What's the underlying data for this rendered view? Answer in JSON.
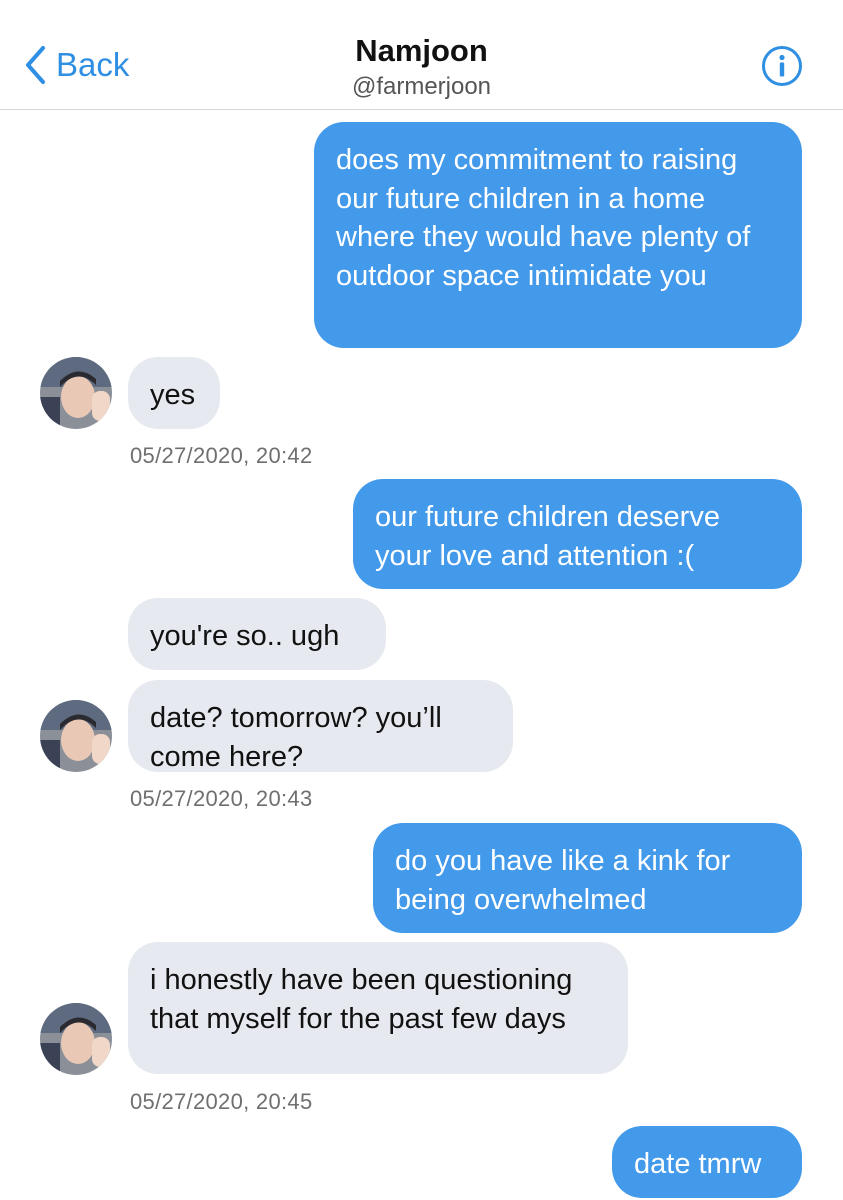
{
  "header": {
    "back_label": "Back",
    "title": "Namjoon",
    "handle": "@farmerjoon"
  },
  "colors": {
    "accent": "#2f8fe3",
    "outgoing_bubble": "#4399ea",
    "incoming_bubble": "#e6e9ef"
  },
  "messages": [
    {
      "direction": "outgoing",
      "text": "does my commitment to raising our future children in a home where they would have plenty of outdoor space intimidate you"
    },
    {
      "direction": "incoming",
      "text": "yes"
    },
    {
      "direction": "outgoing",
      "text": "our future children deserve your love and attention :("
    },
    {
      "direction": "incoming",
      "text": "you're so.. ugh"
    },
    {
      "direction": "incoming",
      "text": "date? tomorrow? you’ll come here?"
    },
    {
      "direction": "outgoing",
      "text": "do you have like a kink for being overwhelmed"
    },
    {
      "direction": "incoming",
      "text": "i honestly have been questioning that myself for the past few days"
    },
    {
      "direction": "outgoing",
      "text": "date tmrw"
    }
  ],
  "timestamps": [
    "05/27/2020, 20:42",
    "05/27/2020, 20:43",
    "05/27/2020, 20:45"
  ],
  "icons": {
    "back": "chevron-left-icon",
    "info": "info-circle-icon",
    "avatar": "contact-avatar"
  }
}
